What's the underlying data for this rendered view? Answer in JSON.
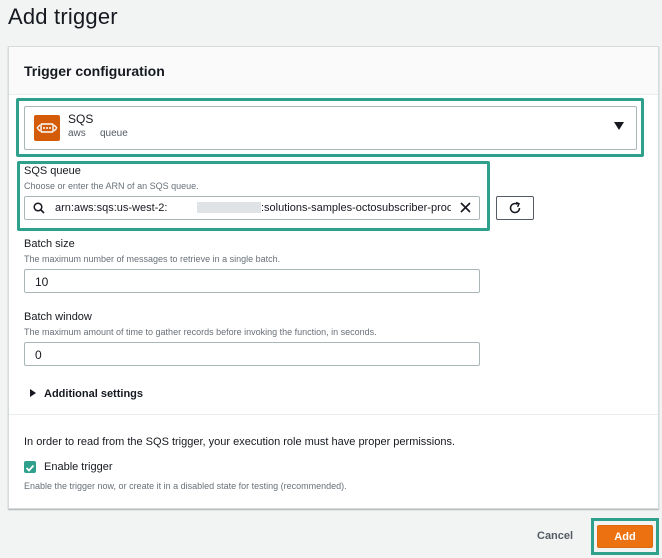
{
  "page": {
    "title": "Add trigger"
  },
  "panel": {
    "title": "Trigger configuration"
  },
  "trigger": {
    "name": "SQS",
    "tags": [
      "aws",
      "queue"
    ],
    "icon": "sqs-icon",
    "accent": "#d45b07"
  },
  "sqs_queue": {
    "label": "SQS queue",
    "description": "Choose or enter the ARN of an SQS queue.",
    "value_prefix": "arn:aws:sqs:us-west-2:",
    "value_suffix": ":solutions-samples-octosubscriber-produ"
  },
  "batch_size": {
    "label": "Batch size",
    "description": "The maximum number of messages to retrieve in a single batch.",
    "value": "10"
  },
  "batch_window": {
    "label": "Batch window",
    "description": "The maximum amount of time to gather records before invoking the function, in seconds.",
    "value": "0"
  },
  "additional_settings": {
    "label": "Additional settings"
  },
  "permissions_note": "In order to read from the SQS trigger, your execution role must have proper permissions.",
  "enable_trigger": {
    "label": "Enable trigger",
    "checked": true,
    "description": "Enable the trigger now, or create it in a disabled state for testing (recommended)."
  },
  "actions": {
    "cancel": "Cancel",
    "add": "Add"
  },
  "colors": {
    "highlight": "#2fa08c",
    "primary": "#ec7211"
  }
}
